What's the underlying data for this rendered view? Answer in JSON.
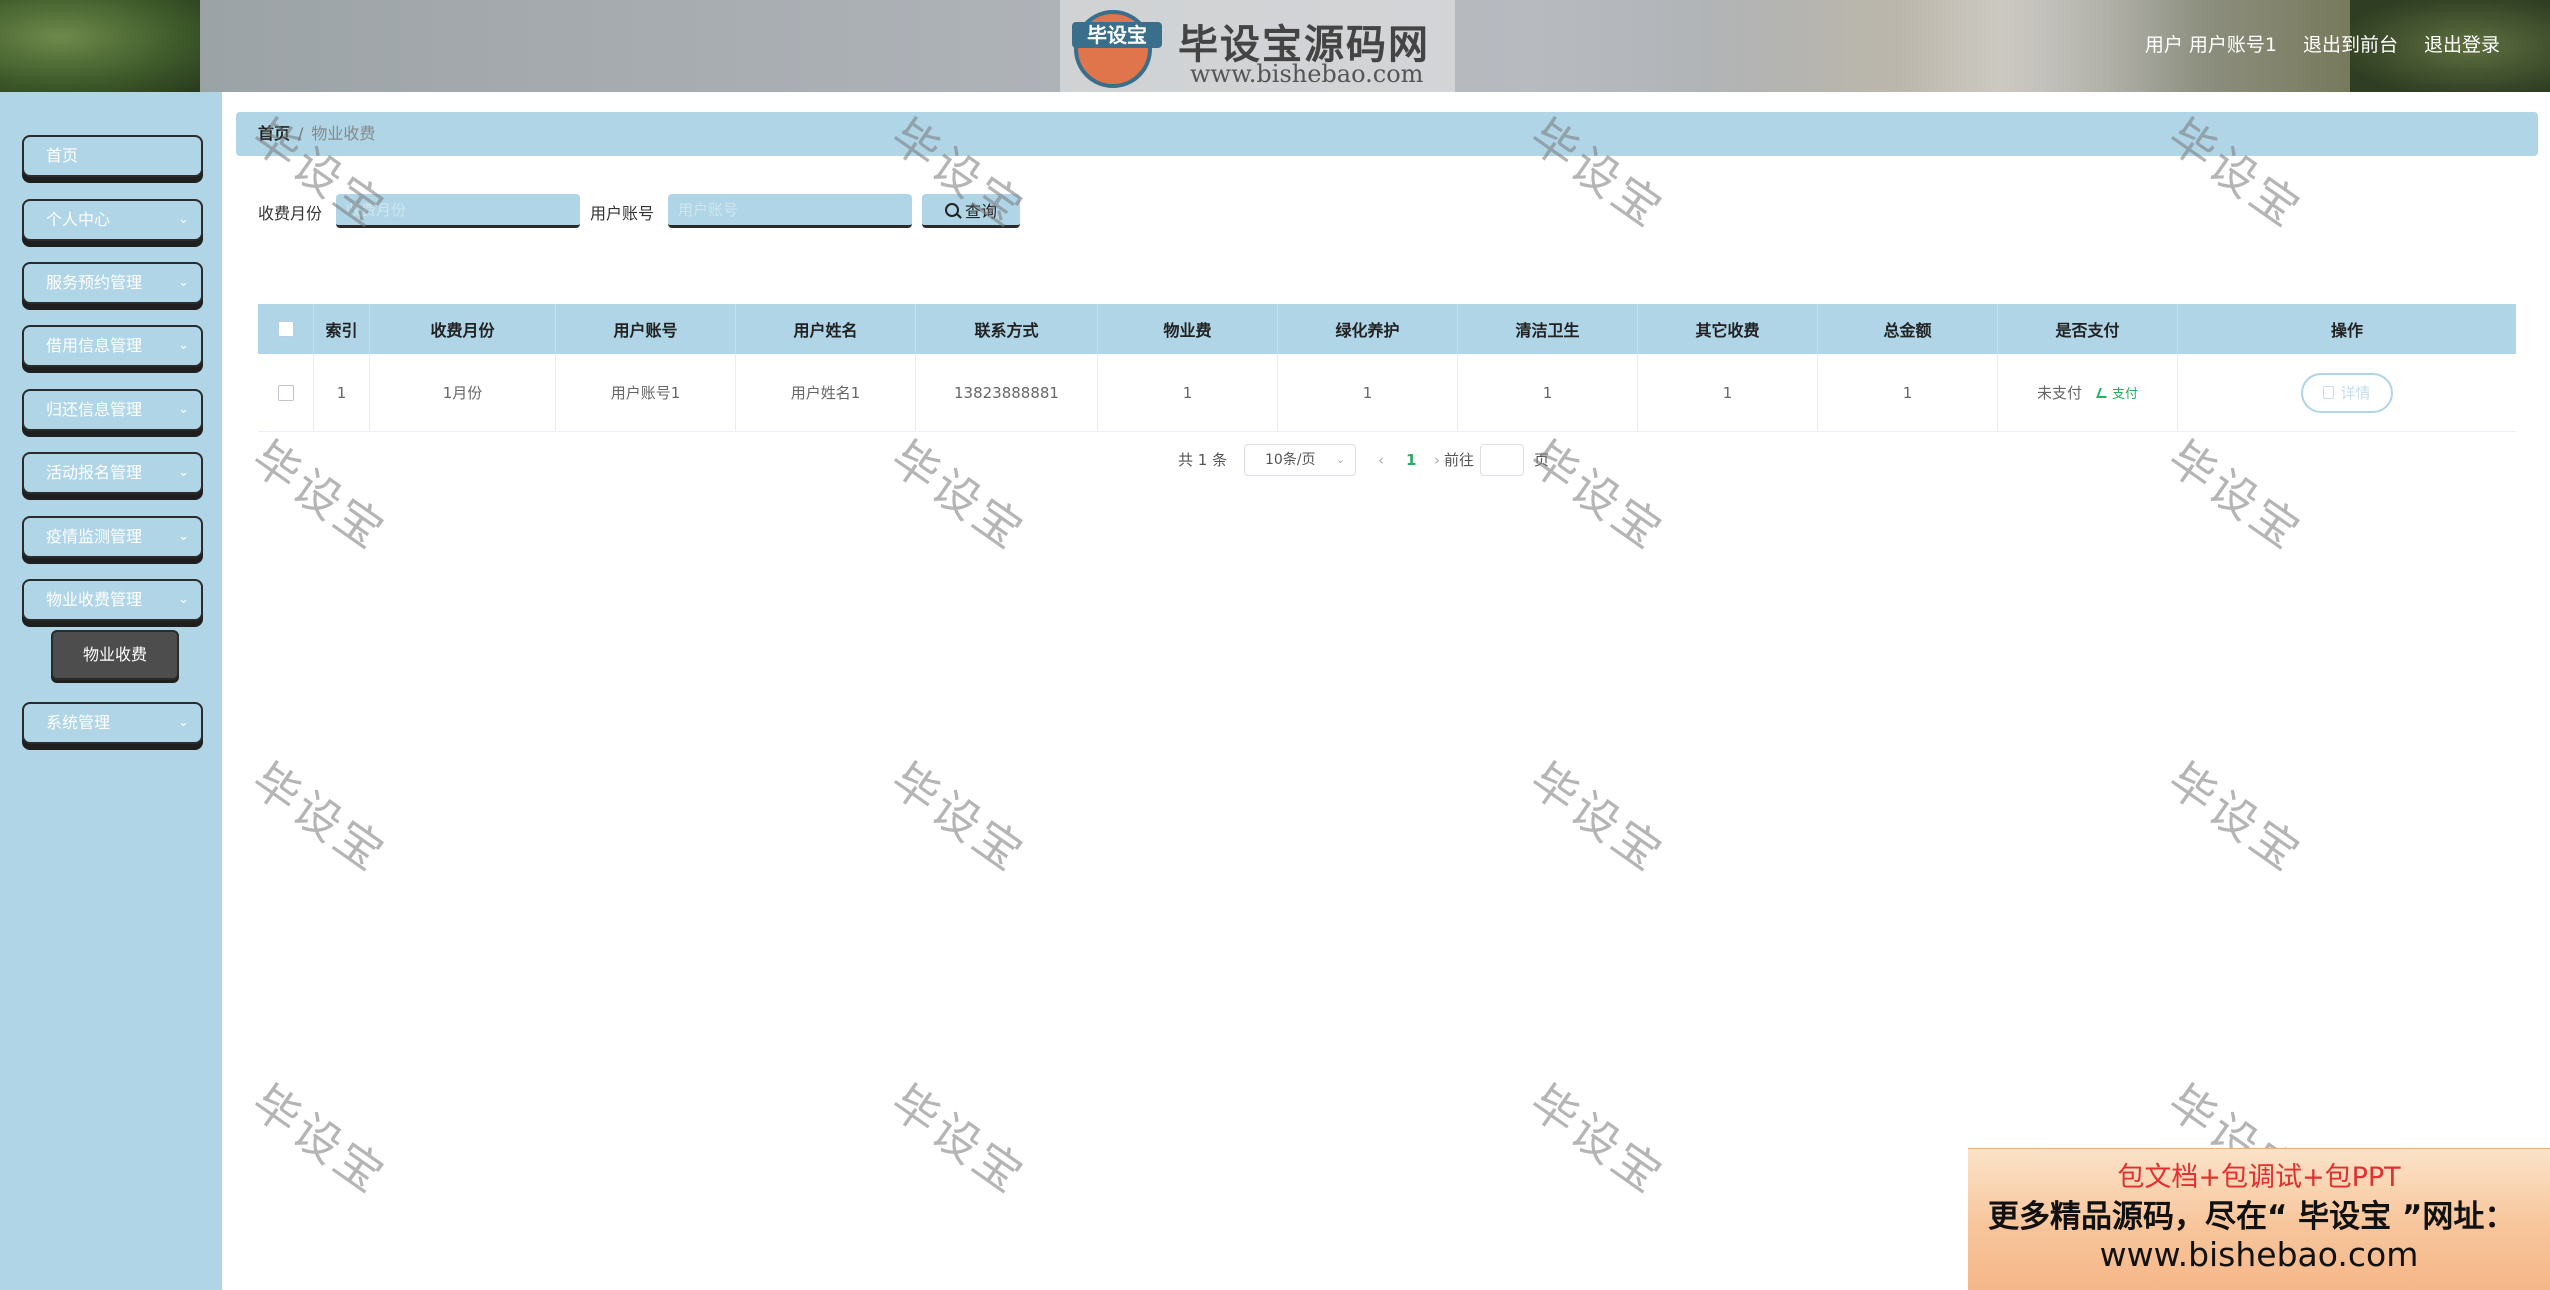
{
  "header": {
    "logo_badge": "毕设宝",
    "logo_title": "毕设宝源码网",
    "logo_url": "www.bishebao.com",
    "user_label": "用户 用户账号1",
    "links": [
      "退出到前台",
      "退出登录"
    ]
  },
  "sidebar": {
    "items": [
      {
        "label": "首页",
        "has_children": false
      },
      {
        "label": "个人中心",
        "has_children": true
      },
      {
        "label": "服务预约管理",
        "has_children": true
      },
      {
        "label": "借用信息管理",
        "has_children": true
      },
      {
        "label": "归还信息管理",
        "has_children": true
      },
      {
        "label": "活动报名管理",
        "has_children": true
      },
      {
        "label": "疫情监测管理",
        "has_children": true
      },
      {
        "label": "物业收费管理",
        "has_children": true
      },
      {
        "label": "系统管理",
        "has_children": true
      }
    ],
    "active_submenu": "物业收费"
  },
  "breadcrumb": {
    "home": "首页",
    "current": "物业收费"
  },
  "search": {
    "month_label": "收费月份",
    "month_placeholder": "收费月份",
    "account_label": "用户账号",
    "account_placeholder": "用户账号",
    "button_label": "查询"
  },
  "table": {
    "columns": [
      "索引",
      "收费月份",
      "用户账号",
      "用户姓名",
      "联系方式",
      "物业费",
      "绿化养护",
      "清洁卫生",
      "其它收费",
      "总金额",
      "是否支付",
      "操作"
    ],
    "rows": [
      {
        "index": "1",
        "month": "1月份",
        "account": "用户账号1",
        "name": "用户姓名1",
        "phone": "13823888881",
        "property_fee": "1",
        "greening": "1",
        "cleaning": "1",
        "other": "1",
        "total": "1",
        "paid_status": "未支付",
        "pay_action": "支付",
        "detail_action": "详情"
      }
    ]
  },
  "pagination": {
    "total": "共 1 条",
    "page_size": "10条/页",
    "current_page": "1",
    "goto_label": "前往",
    "goto_suffix": "页"
  },
  "watermark": "毕设宝",
  "ad": {
    "line1": "包文档+包调试+包PPT",
    "line2": "更多精品源码，尽在“ 毕设宝 ”网址：",
    "line3": "www.bishebao.com"
  },
  "colors": {
    "accent": "#afd5e6",
    "submenu_active": "#4d4d4d",
    "success": "#27ae60",
    "ad_red": "#e03030"
  }
}
